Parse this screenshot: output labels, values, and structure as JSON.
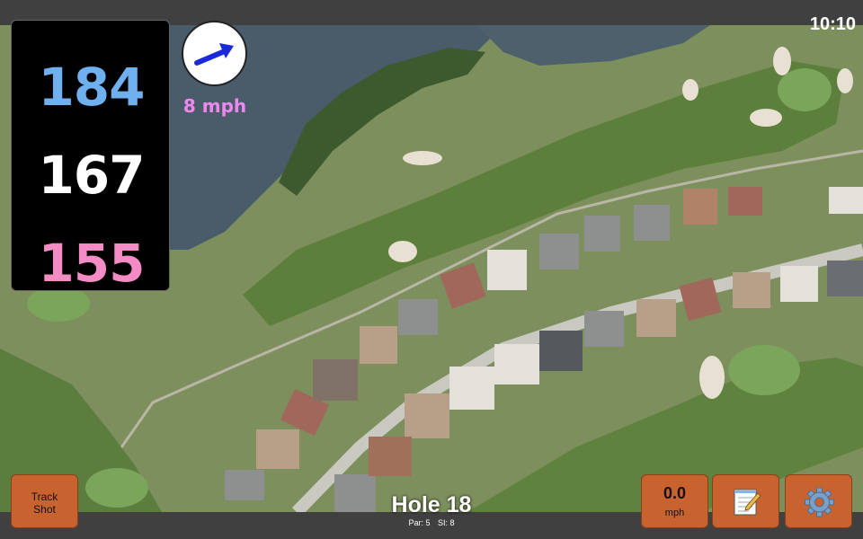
{
  "status_bar": {
    "time": "10:10"
  },
  "distances": {
    "back": "184",
    "middle": "167",
    "front": "155",
    "colors": {
      "back": "#6fb0ee",
      "middle": "#ffffff",
      "front": "#f38bc5"
    }
  },
  "wind": {
    "speed": "8 mph",
    "arrow_icon": "wind-arrow-icon",
    "color": "#ee88ee",
    "arrow_color": "#1a2ad8"
  },
  "buttons": {
    "track_shot_line1": "Track",
    "track_shot_line2": "Shot",
    "speed_value": "0.0",
    "speed_unit": "mph",
    "notes_icon": "notepad-icon",
    "settings_icon": "gear-icon",
    "color": "#c8622e"
  },
  "hole": {
    "title": "Hole 18",
    "par": "Par: 5",
    "si": "SI: 8"
  }
}
